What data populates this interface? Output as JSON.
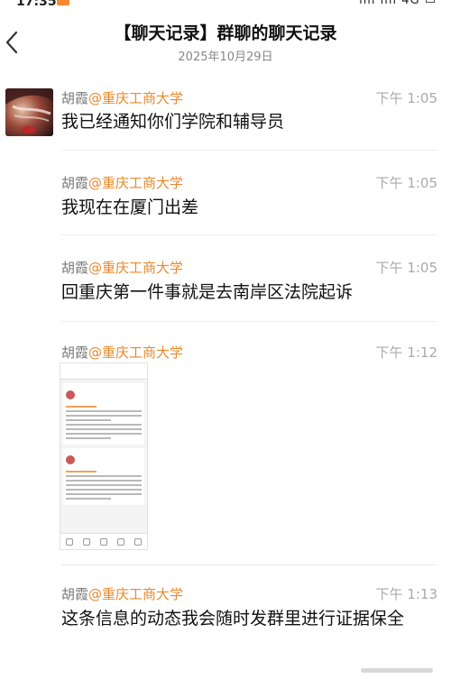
{
  "status_bar": {
    "time": "17:35",
    "icons": "ııll ııll 4G ▭"
  },
  "header": {
    "title": "【聊天记录】群聊的聊天记录",
    "date": "2025年10月29日"
  },
  "messages": [
    {
      "sender_name": "胡霞",
      "sender_org": "@重庆工商大学",
      "time": "下午 1:05",
      "text": "我已经通知你们学院和辅导员"
    },
    {
      "sender_name": "胡霞",
      "sender_org": "@重庆工商大学",
      "time": "下午 1:05",
      "text": "我现在在厦门出差"
    },
    {
      "sender_name": "胡霞",
      "sender_org": "@重庆工商大学",
      "time": "下午 1:05",
      "text": "回重庆第一件事就是去南岸区法院起诉"
    },
    {
      "sender_name": "胡霞",
      "sender_org": "@重庆工商大学",
      "time": "下午 1:12",
      "text": ""
    },
    {
      "sender_name": "胡霞",
      "sender_org": "@重庆工商大学",
      "time": "下午 1:13",
      "text": "这条信息的动态我会随时发群里进行证据保全"
    }
  ],
  "icons": {
    "back": "chevron-left-icon",
    "avatar": "user-avatar",
    "thumbnail": "screenshot-thumbnail"
  },
  "colors": {
    "org": "#e8892e",
    "name": "#777777",
    "time": "#aaaaaa",
    "text": "#111111"
  }
}
